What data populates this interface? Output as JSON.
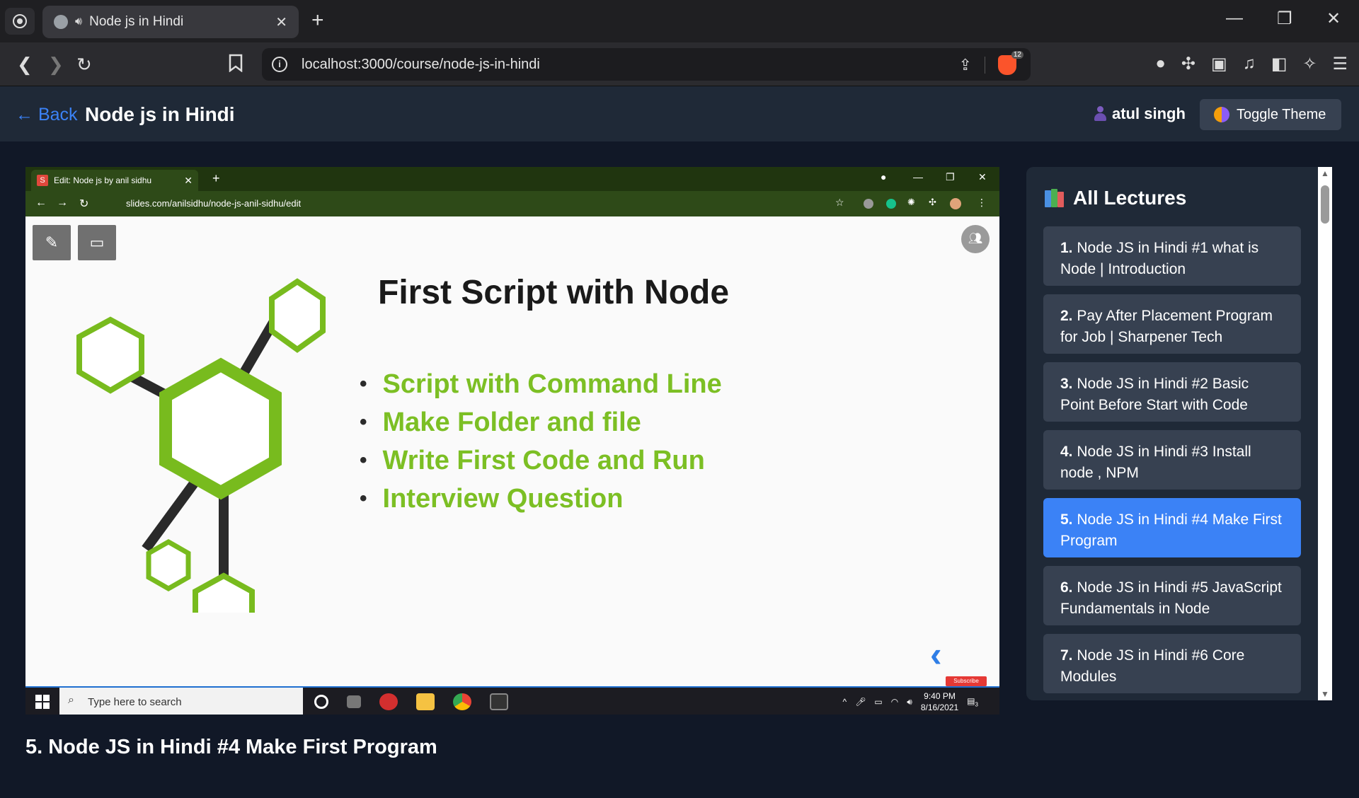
{
  "browser": {
    "tab_title": "Node js in Hindi",
    "url": "localhost:3000/course/node-js-in-hindi",
    "shield_count": "12"
  },
  "header": {
    "back_label": "← Back",
    "course_title": "Node js in Hindi",
    "user_name": "atul singh",
    "toggle_label": "Toggle Theme"
  },
  "video": {
    "inner_tab_title": "Edit: Node js by anil sidhu",
    "inner_url": "slides.com/anilsidhu/node-js-anil-sidhu/edit",
    "slide_title": "First Script with Node",
    "bullets": [
      "Script with Command Line",
      "Make Folder and file",
      "Write First Code and Run",
      "Interview Question"
    ],
    "subscribe": "Subscribe",
    "taskbar_search": "Type here to search",
    "clock_time": "9:40 PM",
    "clock_date": "8/16/2021",
    "notification_count": "3"
  },
  "lecture_title": "5. Node JS in Hindi #4 Make First Program",
  "sidebar": {
    "heading": "All Lectures",
    "lectures": [
      {
        "num": "1.",
        "title": "Node JS in Hindi #1 what is Node | Introduction"
      },
      {
        "num": "2.",
        "title": "Pay After Placement Program for Job | Sharpener Tech"
      },
      {
        "num": "3.",
        "title": "Node JS in Hindi #2 Basic Point Before Start with Code"
      },
      {
        "num": "4.",
        "title": "Node JS in Hindi #3 Install node , NPM"
      },
      {
        "num": "5.",
        "title": "Node JS in Hindi #4 Make First Program"
      },
      {
        "num": "6.",
        "title": "Node JS in Hindi #5 JavaScript Fundamentals in Node"
      },
      {
        "num": "7.",
        "title": "Node JS in Hindi #6 Core Modules"
      }
    ],
    "active_index": 4
  }
}
